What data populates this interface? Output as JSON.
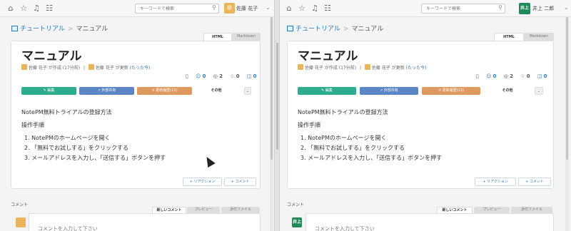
{
  "left": {
    "search_placeholder": "キーワードで検索",
    "user_name": "佐藤 花子",
    "breadcrumb": {
      "section": "チュートリアル",
      "page": "マニュアル"
    },
    "tabs": [
      "HTML",
      "Markdown"
    ],
    "title": "マニュアル",
    "meta": {
      "created": "佐藤 花子 が作成 (17分前)",
      "updated_by": "佐藤 花子 が更新",
      "updated_when": "(たった今)"
    },
    "stats": {
      "reactions": "0",
      "views": "2",
      "stars": "0",
      "comments": "0"
    },
    "buttons": {
      "edit": "編集",
      "share": "外部共有",
      "history": "更新履歴(13)",
      "other": "その他",
      "more": "⌄"
    },
    "content": {
      "heading": "NotePM無料トライアルの登録方法",
      "subheading": "操作手順",
      "steps": [
        "1. NotePMのホームページを開く",
        "2. 「無料でお試しする」をクリックする",
        "3. メールアドレスを入力し、「送信する」ボタンを押す"
      ]
    },
    "reaction_btn": "+ リアクション",
    "comment_btn": "+ コメント",
    "comment_label": "コメント",
    "comment_tabs": [
      "新しいコメント",
      "プレビュー",
      "添付ファイル"
    ],
    "comment_placeholder": "コメントを入力して下さい"
  },
  "right": {
    "search_placeholder": "キーワードで検索",
    "user_initials": "井上",
    "user_name": "井上 二郎",
    "breadcrumb": {
      "section": "チュートリアル",
      "page": "マニュアル"
    },
    "tabs": [
      "HTML",
      "Markdown"
    ],
    "title": "マニュアル",
    "meta": {
      "created": "佐藤 花子 が作成 (17分前)",
      "updated_by": "佐藤 花子 が更新",
      "updated_when": "(たった今)"
    },
    "stats": {
      "reactions": "0",
      "views": "2",
      "stars": "0",
      "comments": "0"
    },
    "buttons": {
      "edit": "編集",
      "share": "外部共有",
      "history": "更新履歴(13)",
      "other": "その他",
      "more": "⌄"
    },
    "content": {
      "heading": "NotePM無料トライアルの登録方法",
      "subheading": "操作手順",
      "steps": [
        "1. NotePMのホームページを開く",
        "2. 「無料でお試しする」をクリックする",
        "3. メールアドレスを入力し、「送信する」ボタンを押す"
      ]
    },
    "reaction_btn": "+ リアクション",
    "comment_btn": "+ コメント",
    "comment_label": "コメント",
    "comment_tabs": [
      "新しいコメント",
      "プレビュー",
      "添付ファイル"
    ],
    "comment_placeholder": "コメントを入力して下さい"
  },
  "icons": {
    "home": "home-icon",
    "star": "star-icon",
    "bell": "bell-icon",
    "users": "users-icon",
    "search": "search-icon"
  },
  "colors": {
    "edit": "#2eac8e",
    "share": "#5b86c5",
    "history": "#dd995e",
    "link": "#2a7ab8",
    "avatar_green": "#1e8a5a"
  }
}
